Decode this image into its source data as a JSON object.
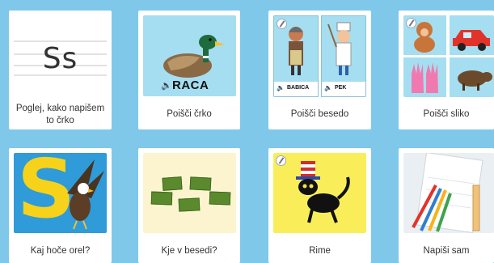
{
  "cards": [
    {
      "caption": "Poglej, kako napišem to črko",
      "letters": "Ss"
    },
    {
      "caption": "Poišči črko",
      "speaker": "🔈",
      "word": "RACA"
    },
    {
      "caption": "Poišči besedo",
      "words": [
        "BABICA",
        "PEK"
      ]
    },
    {
      "caption": "Poišči sliko"
    },
    {
      "caption": "Kaj hoče orel?",
      "letter": "S"
    },
    {
      "caption": "Kje v besedi?",
      "tiles": [
        "",
        "",
        "",
        ""
      ]
    },
    {
      "caption": "Rime"
    },
    {
      "caption": "Napiši sam"
    }
  ],
  "colors": {
    "background": "#7fc8ea",
    "duck_bg": "#a6def1",
    "orel_bg": "#2f9bd8",
    "letter_yellow": "#f7d21a",
    "rime_bg": "#f9ee5a"
  }
}
